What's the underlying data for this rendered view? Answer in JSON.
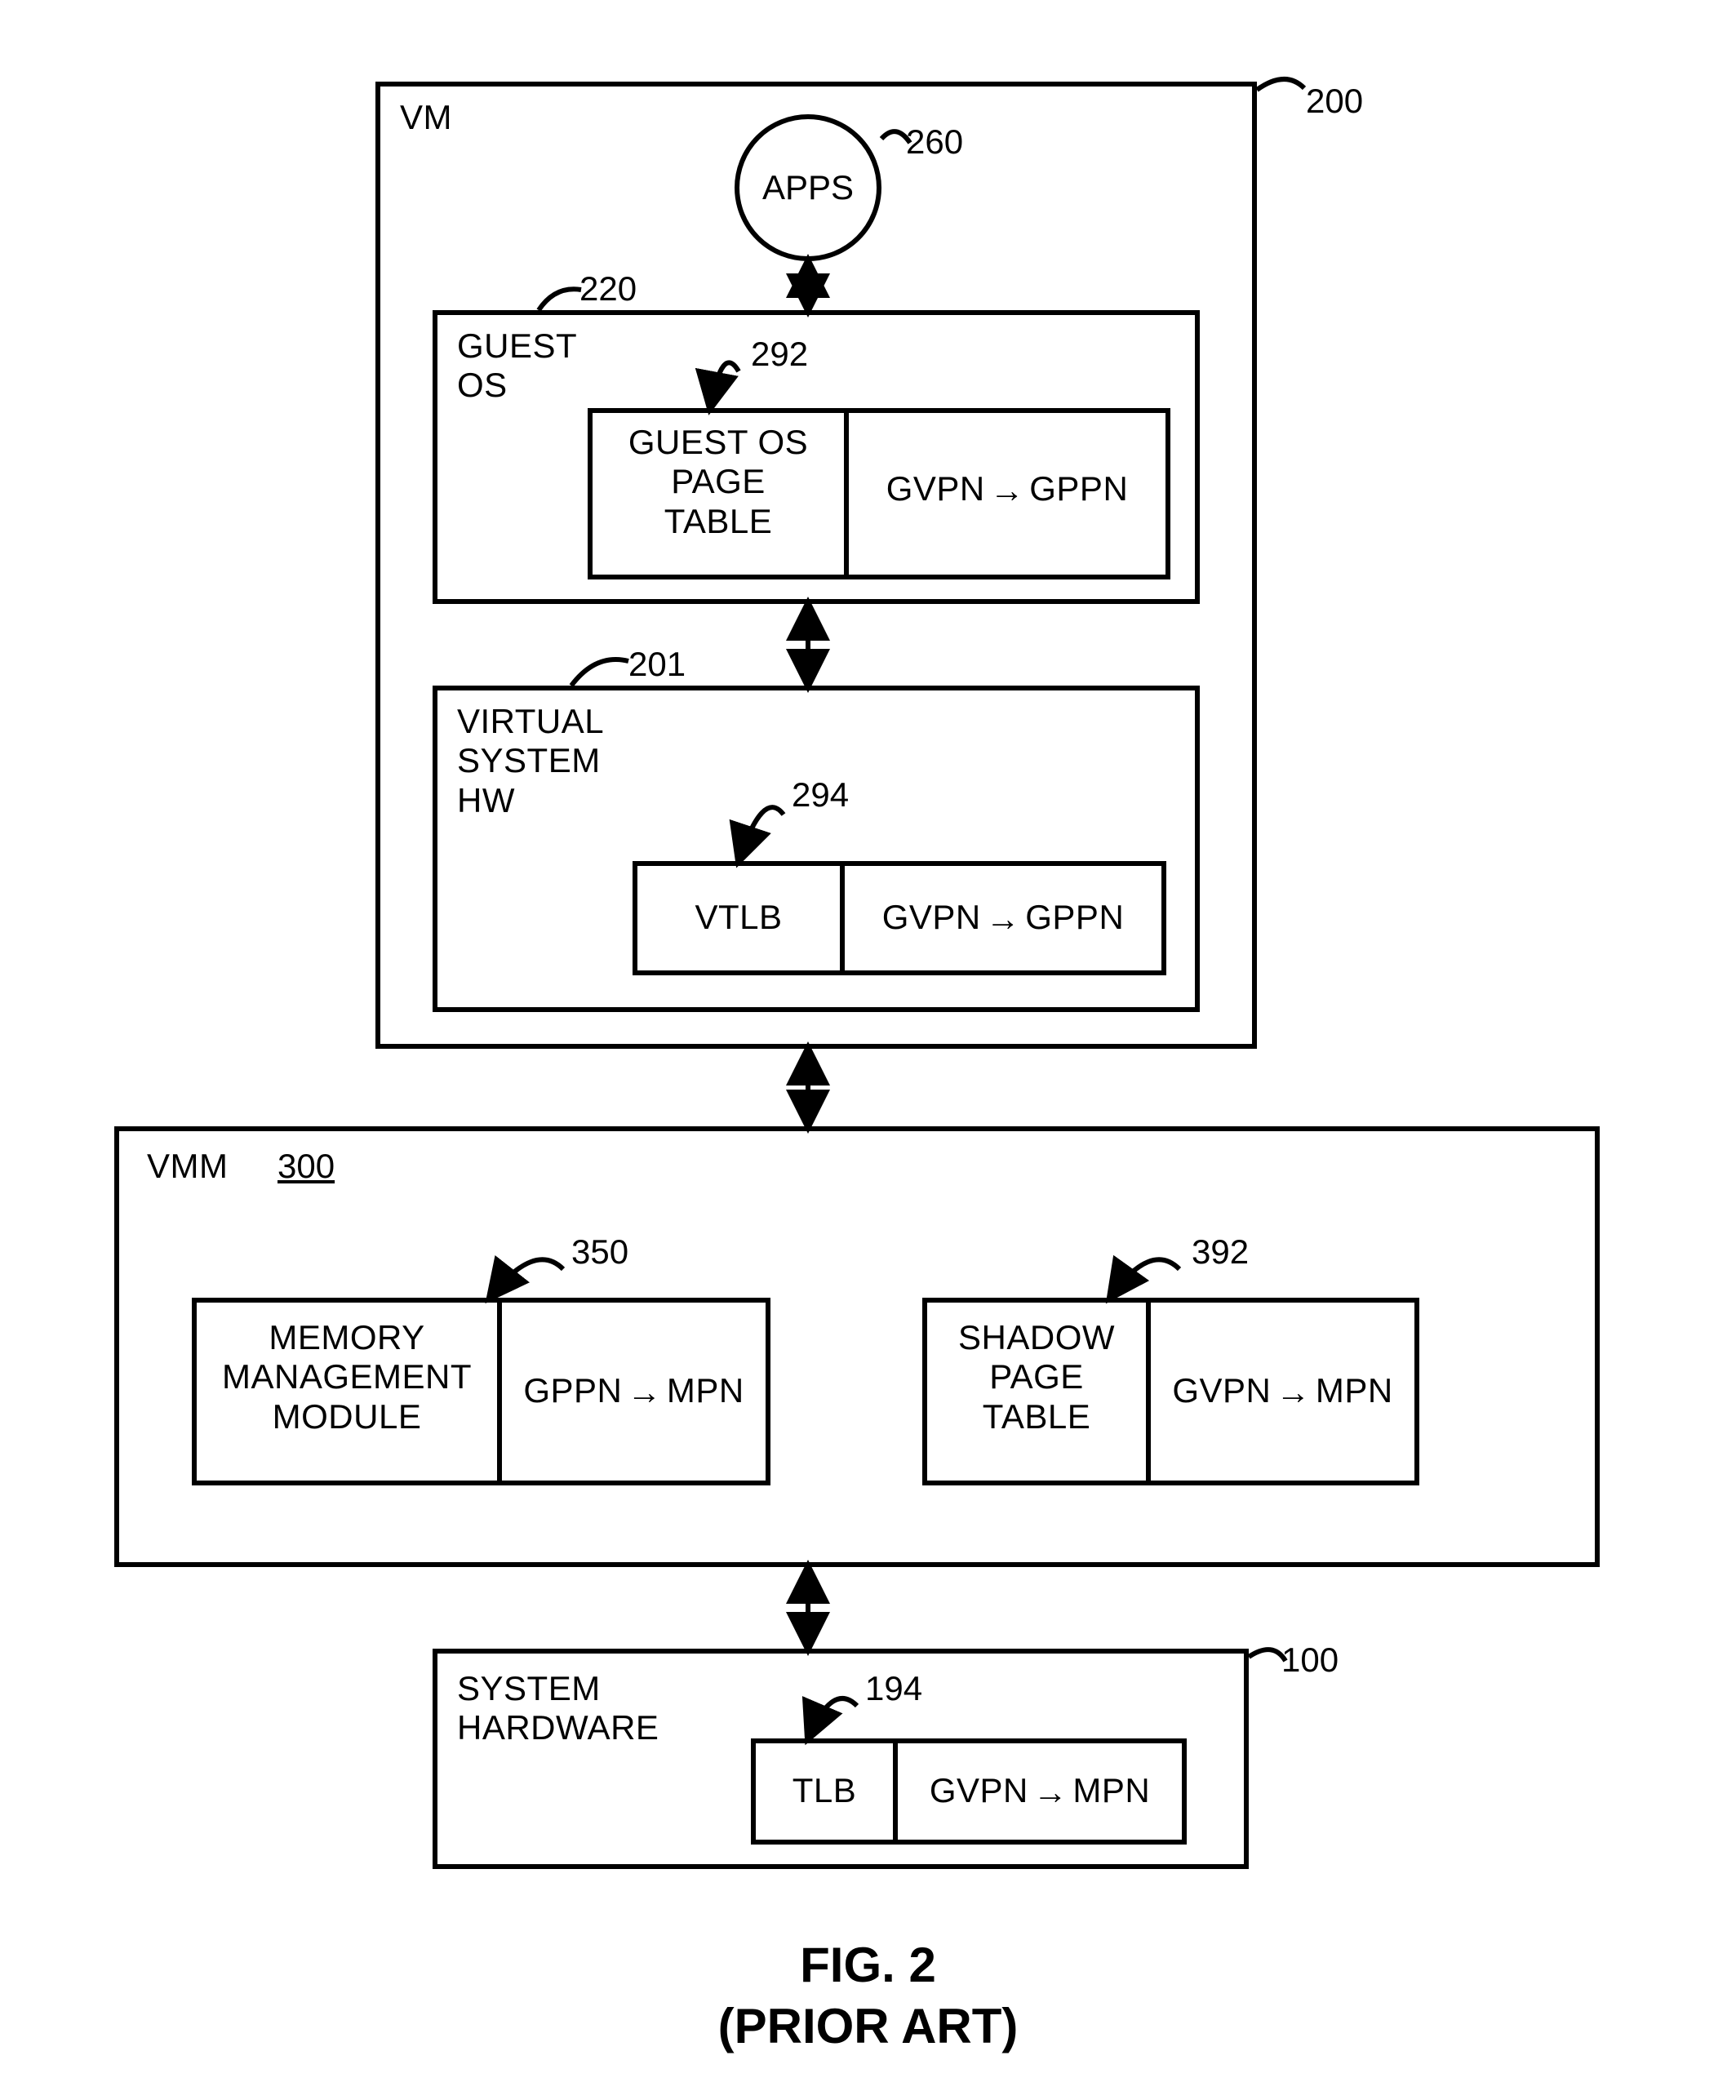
{
  "refs": {
    "vm": "200",
    "apps": "260",
    "guest_os": "220",
    "guest_page_table": "292",
    "virtual_hw": "201",
    "vtlb": "294",
    "vmm": "300",
    "mem_mgmt": "350",
    "shadow_pt": "392",
    "sys_hw": "100",
    "tlb": "194"
  },
  "labels": {
    "vm": "VM",
    "apps": "APPS",
    "guest_os": "GUEST\nOS",
    "guest_page_table": "GUEST OS\nPAGE\nTABLE",
    "gvpn_gppn": {
      "lhs": "GVPN",
      "rhs": "GPPN"
    },
    "virtual_hw": "VIRTUAL\nSYSTEM\nHW",
    "vtlb": "VTLB",
    "vmm": "VMM",
    "mem_mgmt": "MEMORY\nMANAGEMENT\nMODULE",
    "gppn_mpn": {
      "lhs": "GPPN",
      "rhs": "MPN"
    },
    "shadow_pt": "SHADOW\nPAGE\nTABLE",
    "gvpn_mpn": {
      "lhs": "GVPN",
      "rhs": "MPN"
    },
    "sys_hw": "SYSTEM\nHARDWARE",
    "tlb": "TLB"
  },
  "figure": {
    "title": "FIG. 2",
    "subtitle": "(PRIOR ART)"
  }
}
